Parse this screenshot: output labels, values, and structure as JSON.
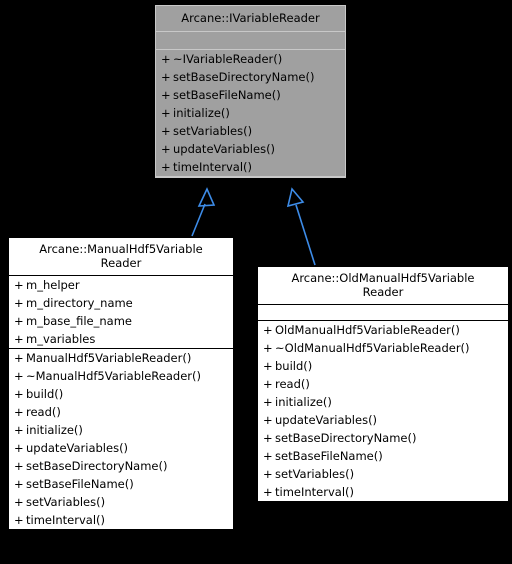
{
  "diagram": {
    "type": "uml-class-inheritance",
    "background_color": "#000000",
    "base_fill_color": "#a0a0a0",
    "derived_fill_color": "#ffffff",
    "edge_color": "#3d8ce8",
    "title": "Arcane::IVariableReader inheritance diagram"
  },
  "classes": {
    "base": {
      "name": "Arcane::IVariableReader",
      "attributes": [],
      "methods": [
        {
          "visibility": "+",
          "label": "~IVariableReader()"
        },
        {
          "visibility": "+",
          "label": "setBaseDirectoryName()"
        },
        {
          "visibility": "+",
          "label": "setBaseFileName()"
        },
        {
          "visibility": "+",
          "label": "initialize()"
        },
        {
          "visibility": "+",
          "label": "setVariables()"
        },
        {
          "visibility": "+",
          "label": "updateVariables()"
        },
        {
          "visibility": "+",
          "label": "timeInterval()"
        }
      ]
    },
    "manual": {
      "name": "Arcane::ManualHdf5Variable Reader",
      "name_line1": "Arcane::ManualHdf5Variable",
      "name_line2": "Reader",
      "attributes": [
        {
          "visibility": "+",
          "label": "m_helper"
        },
        {
          "visibility": "+",
          "label": "m_directory_name"
        },
        {
          "visibility": "+",
          "label": "m_base_file_name"
        },
        {
          "visibility": "+",
          "label": "m_variables"
        }
      ],
      "methods": [
        {
          "visibility": "+",
          "label": "ManualHdf5VariableReader()"
        },
        {
          "visibility": "+",
          "label": "~ManualHdf5VariableReader()"
        },
        {
          "visibility": "+",
          "label": "build()"
        },
        {
          "visibility": "+",
          "label": "read()"
        },
        {
          "visibility": "+",
          "label": "initialize()"
        },
        {
          "visibility": "+",
          "label": "updateVariables()"
        },
        {
          "visibility": "+",
          "label": "setBaseDirectoryName()"
        },
        {
          "visibility": "+",
          "label": "setBaseFileName()"
        },
        {
          "visibility": "+",
          "label": "setVariables()"
        },
        {
          "visibility": "+",
          "label": "timeInterval()"
        }
      ]
    },
    "oldmanual": {
      "name": "Arcane::OldManualHdf5Variable Reader",
      "name_line1": "Arcane::OldManualHdf5Variable",
      "name_line2": "Reader",
      "attributes": [],
      "methods": [
        {
          "visibility": "+",
          "label": "OldManualHdf5VariableReader()"
        },
        {
          "visibility": "+",
          "label": "~OldManualHdf5VariableReader()"
        },
        {
          "visibility": "+",
          "label": "build()"
        },
        {
          "visibility": "+",
          "label": "read()"
        },
        {
          "visibility": "+",
          "label": "initialize()"
        },
        {
          "visibility": "+",
          "label": "updateVariables()"
        },
        {
          "visibility": "+",
          "label": "setBaseDirectoryName()"
        },
        {
          "visibility": "+",
          "label": "setBaseFileName()"
        },
        {
          "visibility": "+",
          "label": "setVariables()"
        },
        {
          "visibility": "+",
          "label": "timeInterval()"
        }
      ]
    }
  },
  "edges": [
    {
      "from": "manual",
      "to": "base",
      "kind": "generalization"
    },
    {
      "from": "oldmanual",
      "to": "base",
      "kind": "generalization"
    }
  ]
}
